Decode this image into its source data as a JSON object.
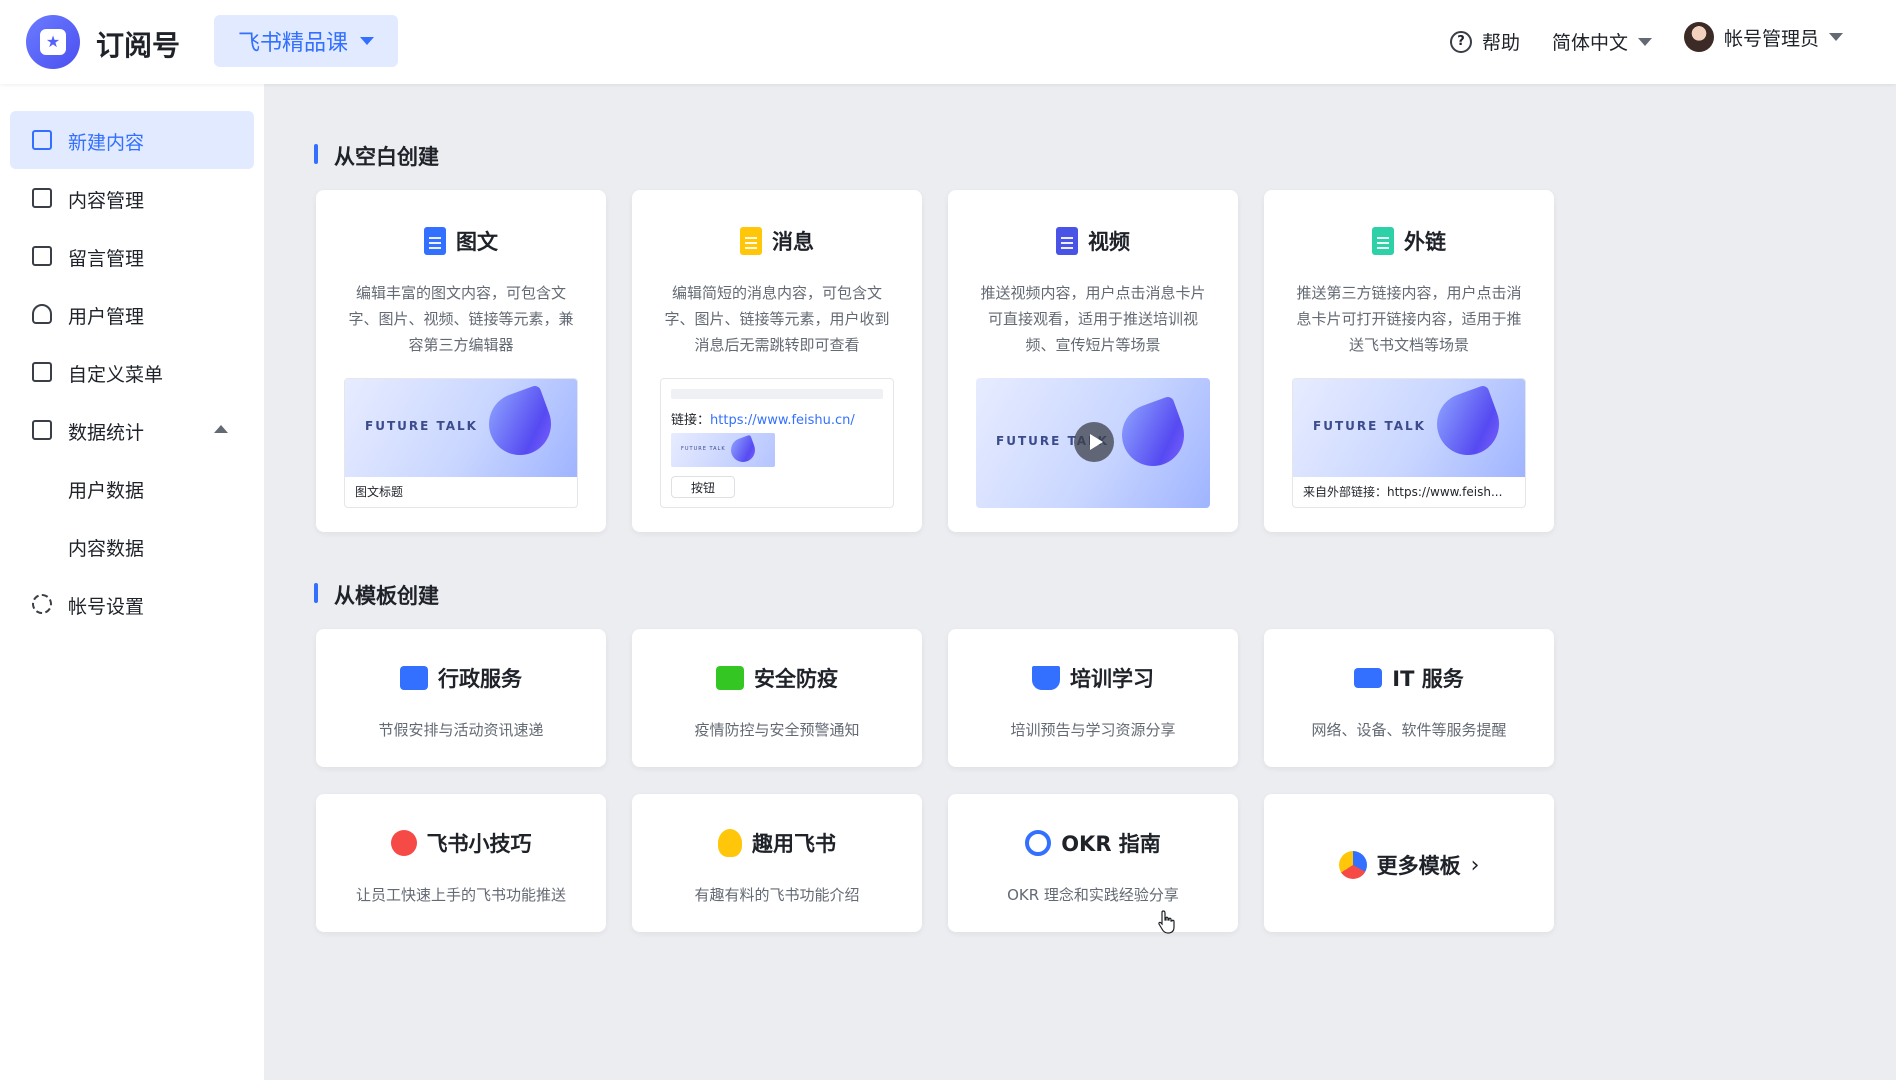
{
  "header": {
    "app_title": "订阅号",
    "account_name": "飞书精品课",
    "help_label": "帮助",
    "language_label": "简体中文",
    "user_label": "帐号管理员"
  },
  "sidebar": {
    "items": [
      {
        "label": "新建内容",
        "active": true
      },
      {
        "label": "内容管理"
      },
      {
        "label": "留言管理"
      },
      {
        "label": "用户管理"
      },
      {
        "label": "自定义菜单"
      },
      {
        "label": "数据统计",
        "expanded": true,
        "children": [
          "用户数据",
          "内容数据"
        ]
      },
      {
        "label": "帐号设置"
      }
    ]
  },
  "blank_section": {
    "title": "从空白创建",
    "cards": [
      {
        "title": "图文",
        "icon": "doc-blue-icon",
        "color": "#3370ff",
        "description": "编辑丰富的图文内容，可包含文字、图片、视频、链接等元素，兼容第三方编辑器",
        "preview": {
          "banner_text": "FUTURE TALK",
          "caption": "图文标题"
        }
      },
      {
        "title": "消息",
        "icon": "doc-yellow-icon",
        "color": "#ffc60a",
        "description": "编辑简短的消息内容，可包含文字、图片、链接等元素，用户收到消息后无需跳转即可查看",
        "preview": {
          "link_label": "链接：",
          "link_url": "https://www.feishu.cn/",
          "button_label": "按钮",
          "thumb_text": "FUTURE TALK"
        }
      },
      {
        "title": "视频",
        "icon": "doc-indigo-icon",
        "color": "#4954e6",
        "description": "推送视频内容，用户点击消息卡片可直接观看，适用于推送培训视频、宣传短片等场景",
        "preview": {
          "banner_text": "FUTURE TALK"
        }
      },
      {
        "title": "外链",
        "icon": "doc-green-icon",
        "color": "#2ed1a7",
        "description": "推送第三方链接内容，用户点击消息卡片可打开链接内容，适用于推送飞书文档等场景",
        "preview": {
          "banner_text": "FUTURE TALK",
          "caption": "来自外部链接：https://www.feish..."
        }
      }
    ]
  },
  "template_section": {
    "title": "从模板创建",
    "cards": [
      {
        "title": "行政服务",
        "description": "节假安排与活动资讯速递",
        "icon": "folder-heart-icon",
        "color": "#3370ff"
      },
      {
        "title": "安全防疫",
        "description": "疫情防控与安全预警通知",
        "icon": "medical-kit-icon",
        "color": "#34c724"
      },
      {
        "title": "培训学习",
        "description": "培训预告与学习资源分享",
        "icon": "graduation-cap-icon",
        "color": "#3370ff"
      },
      {
        "title": "IT 服务",
        "description": "网络、设备、软件等服务提醒",
        "icon": "laptop-icon",
        "color": "#3370ff"
      },
      {
        "title": "飞书小技巧",
        "description": "让员工快速上手的飞书功能推送",
        "icon": "award-badge-icon",
        "color": "#f54a45"
      },
      {
        "title": "趣用飞书",
        "description": "有趣有料的飞书功能介绍",
        "icon": "lightbulb-icon",
        "color": "#ffc60a"
      },
      {
        "title": "OKR 指南",
        "description": "OKR 理念和实践经验分享",
        "icon": "target-icon",
        "color": "#3370ff"
      }
    ],
    "more_label": "更多模板"
  }
}
